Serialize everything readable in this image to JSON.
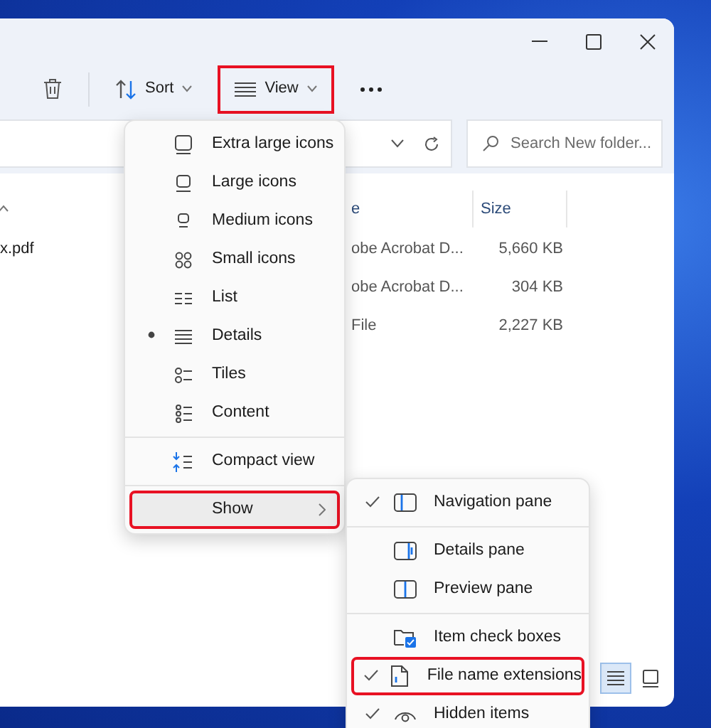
{
  "toolbar": {
    "buttons": [
      {
        "kind": "delete"
      },
      {
        "kind": "sort",
        "label": "Sort",
        "highlighted": false
      },
      {
        "kind": "view",
        "label": "View",
        "highlighted": true
      },
      {
        "kind": "more"
      }
    ]
  },
  "search": {
    "placeholder": "Search New folder..."
  },
  "file_list": {
    "columns": [
      {
        "label": "e"
      },
      {
        "label": "Size"
      }
    ],
    "rows": [
      {
        "name": "x.pdf",
        "type": "obe Acrobat D...",
        "size": "5,660 KB"
      },
      {
        "type": "obe Acrobat D...",
        "size": "304 KB"
      },
      {
        "type": "File",
        "size": "2,227 KB"
      }
    ]
  },
  "view_menu": {
    "groups": [
      [
        {
          "kind": "xlarge",
          "label": "Extra large icons",
          "selected": false
        },
        {
          "kind": "large",
          "label": "Large icons",
          "selected": false
        },
        {
          "kind": "medium",
          "label": "Medium icons",
          "selected": false
        },
        {
          "kind": "small",
          "label": "Small icons",
          "selected": false
        },
        {
          "kind": "list",
          "label": "List",
          "selected": false
        },
        {
          "kind": "details",
          "label": "Details",
          "selected": true
        },
        {
          "kind": "tiles",
          "label": "Tiles",
          "selected": false
        },
        {
          "kind": "content",
          "label": "Content",
          "selected": false
        }
      ],
      [
        {
          "kind": "compact",
          "label": "Compact view",
          "checked": false
        }
      ],
      [
        {
          "kind": "show",
          "label": "Show",
          "highlighted": true
        }
      ]
    ]
  },
  "show_menu": {
    "groups": [
      [
        {
          "kind": "navpane",
          "label": "Navigation pane",
          "checked": true,
          "highlighted": false
        }
      ],
      [
        {
          "kind": "detailspane",
          "label": "Details pane",
          "checked": false,
          "highlighted": false
        },
        {
          "kind": "previewpane",
          "label": "Preview pane",
          "checked": false,
          "highlighted": false
        }
      ],
      [
        {
          "kind": "checkboxes",
          "label": "Item check boxes",
          "checked": false,
          "highlighted": false
        },
        {
          "kind": "extensions",
          "label": "File name extensions",
          "checked": true,
          "highlighted": true
        },
        {
          "kind": "hidden",
          "label": "Hidden items",
          "checked": true,
          "highlighted": false
        }
      ]
    ]
  },
  "view_buttons": [
    {
      "kind": "details",
      "selected": true
    },
    {
      "kind": "thumbnails",
      "selected": false
    }
  ]
}
